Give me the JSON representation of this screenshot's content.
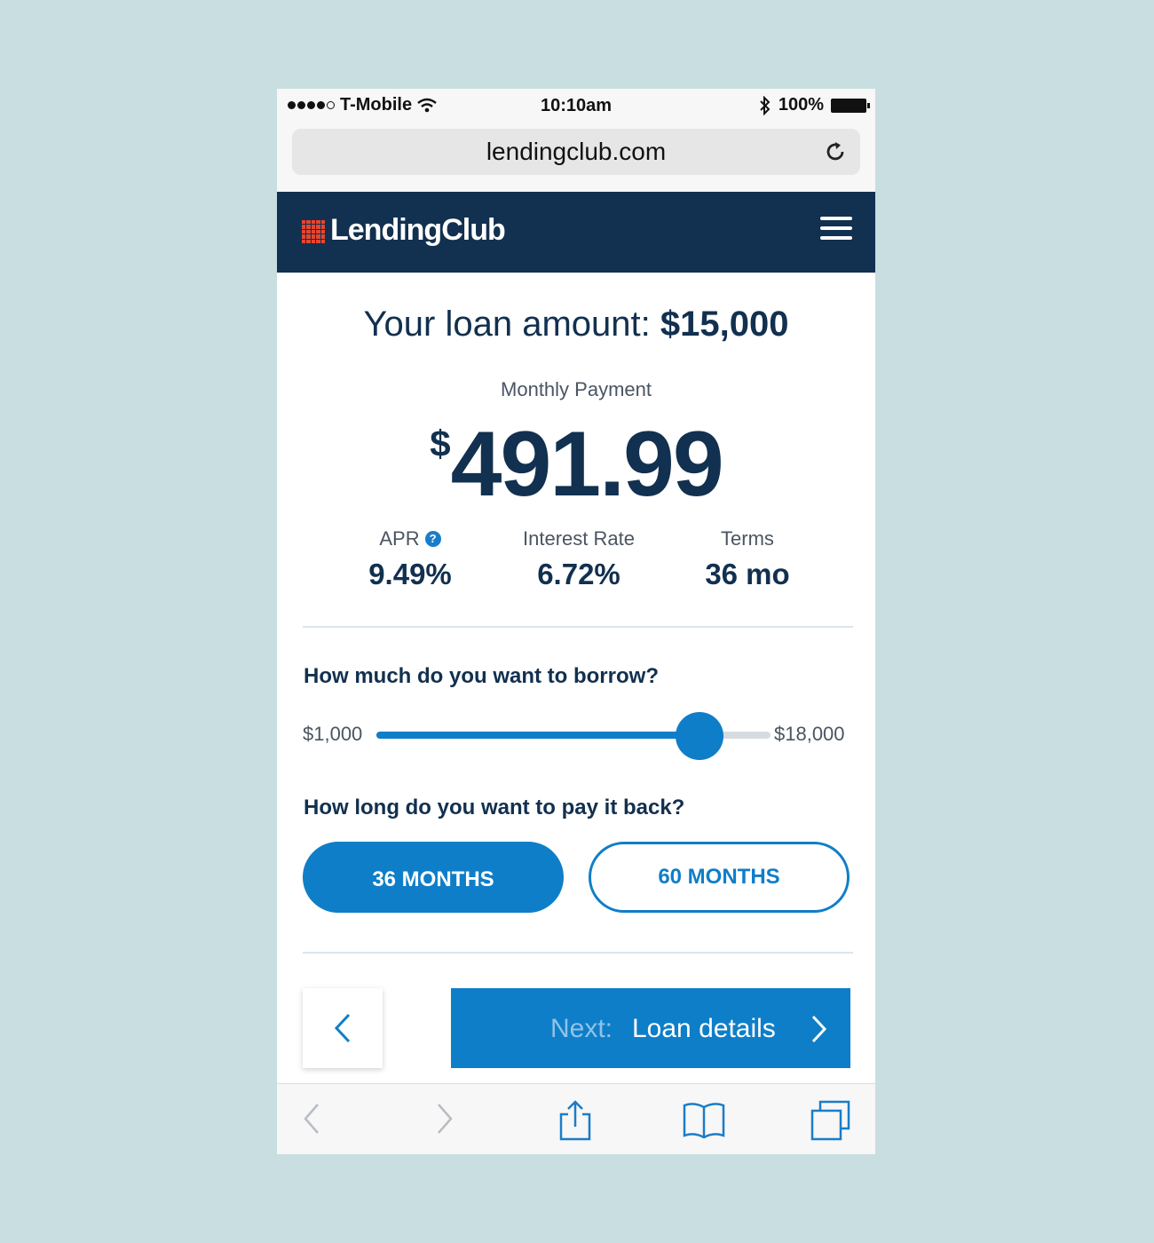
{
  "status_bar": {
    "carrier": "T-Mobile",
    "time": "10:10am",
    "battery": "100%"
  },
  "browser": {
    "url": "lendingclub.com"
  },
  "header": {
    "brand": "LendingClub"
  },
  "loan": {
    "title_prefix": "Your loan amount:",
    "amount": "$15,000",
    "monthly_label": "Monthly Payment",
    "monthly_currency": "$",
    "monthly_amount": "491.99"
  },
  "stats": [
    {
      "label": "APR",
      "value": "9.49%"
    },
    {
      "label": "Interest Rate",
      "value": "6.72%"
    },
    {
      "label": "Terms",
      "value": "36 mo"
    }
  ],
  "borrow": {
    "question": "How much do you want to borrow?",
    "min_label": "$1,000",
    "max_label": "$18,000",
    "slider_fraction": 0.82
  },
  "term": {
    "question": "How long do you want to pay it back?",
    "options": [
      "36 MONTHS",
      "60 MONTHS"
    ],
    "selected": "36 MONTHS"
  },
  "nav": {
    "next_prefix": "Next:",
    "next_label": "Loan details"
  },
  "colors": {
    "brand_navy": "#12304f",
    "accent_blue": "#0f7ec8",
    "logo_red": "#e8452c"
  }
}
